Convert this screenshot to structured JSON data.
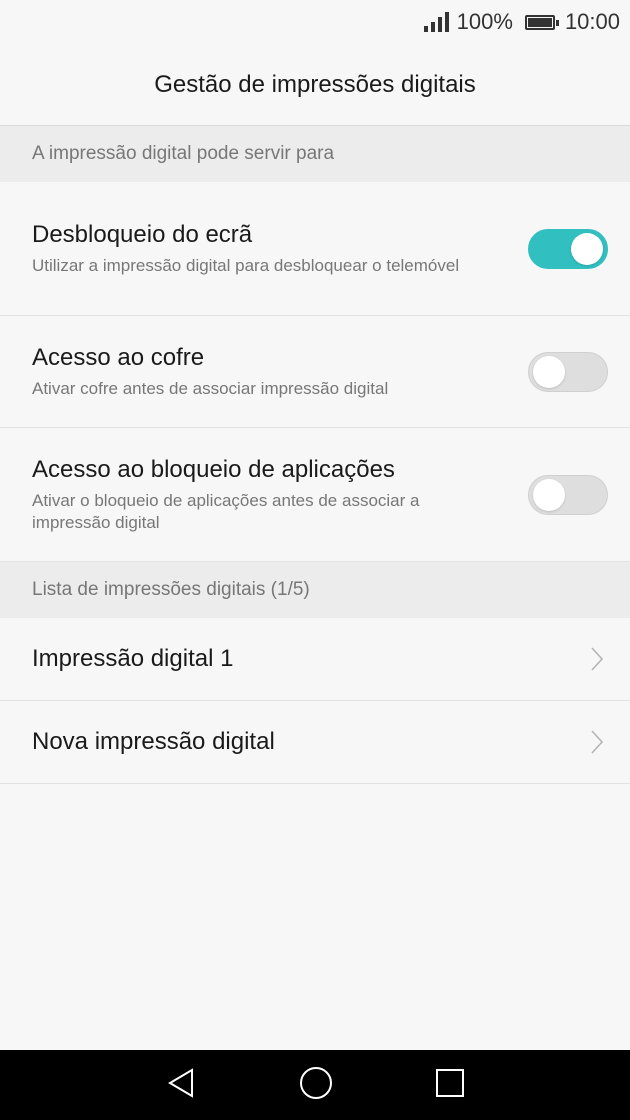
{
  "status_bar": {
    "battery": "100%",
    "time": "10:00"
  },
  "title": "Gestão de impressões digitais",
  "section1": {
    "header": "A impressão digital pode servir para",
    "items": [
      {
        "title": "Desbloqueio do ecrã",
        "subtitle": "Utilizar a impressão digital para desbloquear o telemóvel",
        "enabled": true
      },
      {
        "title": "Acesso ao cofre",
        "subtitle": "Ativar cofre antes de associar impressão digital",
        "enabled": false
      },
      {
        "title": "Acesso ao bloqueio de aplicações",
        "subtitle": "Ativar o bloqueio de aplicações antes de associar a impressão digital",
        "enabled": false
      }
    ]
  },
  "section2": {
    "header": "Lista de impressões digitais (1/5)",
    "items": [
      {
        "label": "Impressão digital 1"
      },
      {
        "label": "Nova impressão digital"
      }
    ]
  },
  "colors": {
    "accent": "#32bfc0",
    "nav_bar": "#000000"
  },
  "nav_icons": [
    "back-icon",
    "home-icon",
    "recents-icon"
  ]
}
